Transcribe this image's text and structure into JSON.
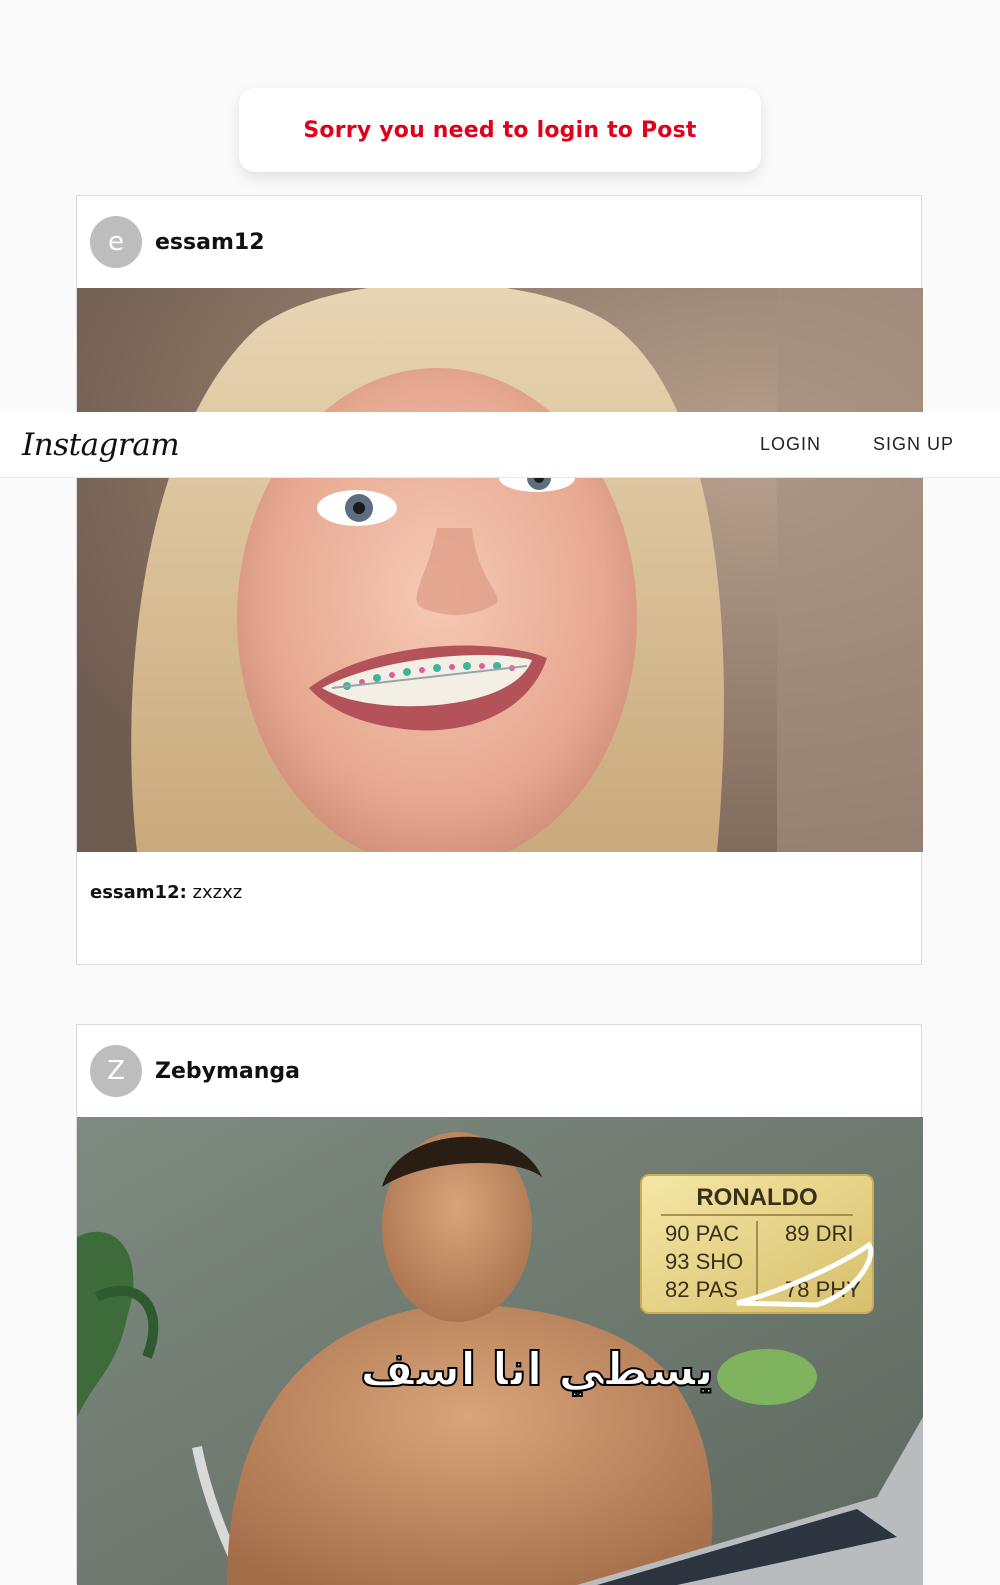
{
  "app": {
    "logo_text": "Instagram"
  },
  "nav": {
    "login_label": "LOGIN",
    "signup_label": "SIGN UP"
  },
  "notice": {
    "text": "Sorry you need to login to Post",
    "color": "#e1001a"
  },
  "posts": [
    {
      "avatar_initial": "e",
      "username": "essam12",
      "image_description": "smiling girl with braces photo",
      "caption_user": "essam12:",
      "caption_text": " zxzxz"
    },
    {
      "avatar_initial": "Z",
      "username": "Zebymanga",
      "image_description": "meme image with player rating card",
      "card": {
        "name": "RONALDO",
        "stats_left": [
          "90 PAC",
          "93 SHO",
          "82 PAS"
        ],
        "stats_right": [
          "89 DRI",
          "78 PHY"
        ]
      },
      "overlay_text": "يسطي انا اسف"
    }
  ]
}
